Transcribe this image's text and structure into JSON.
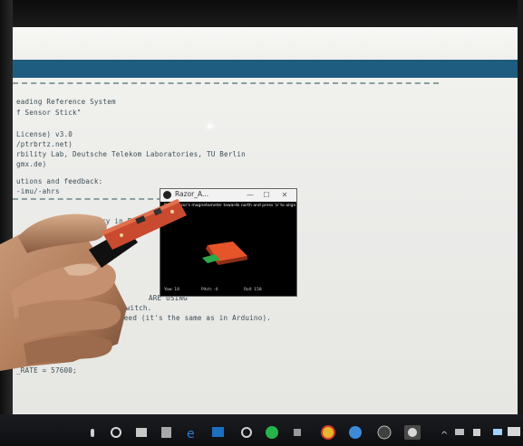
{
  "editor": {
    "lines": [
      "eading Reference System",
      "f Sensor Stick\"",
      "",
      "License) v3.0",
      "/ptrbrtz.net)",
      "rbility Lab, Deutsche Telekom Laboratories, TU Berlin",
      "gmx.de)",
      "",
      "utions and feedback:",
      "-imu/-ahrs",
      "ry in Pro",
      "ARE USING",
      "switch.",
      "need (it's the same as in Arduino).",
      "_RATE = 57600;"
    ]
  },
  "sketch_window": {
    "title": "Razor_A...",
    "minimize": "—",
    "maximize": "☐",
    "close": "✕",
    "instruction": "Point Razor's magnetometer towards north and press 'a' to align",
    "status_yaw": "Yaw: 18",
    "status_pitch": "Pitch: -4",
    "status_roll": "Roll: 158"
  },
  "taskbar": {
    "icons": [
      "microphone-icon",
      "task-view-icon",
      "file-explorer-icon",
      "store-icon",
      "edge-icon",
      "outlook-icon",
      "settings-icon",
      "spotify-icon",
      "arduino-icon",
      "chrome-icon",
      "app-icon",
      "processing-icon",
      "active-sketch-icon",
      "chevron-up-icon",
      "network-icon",
      "volume-icon",
      "battery-icon"
    ]
  },
  "colors": {
    "blue_band": "#1f5d80",
    "board_red": "#d8533a",
    "plane_orange": "#e6542a",
    "plane_green": "#2ea84a"
  }
}
